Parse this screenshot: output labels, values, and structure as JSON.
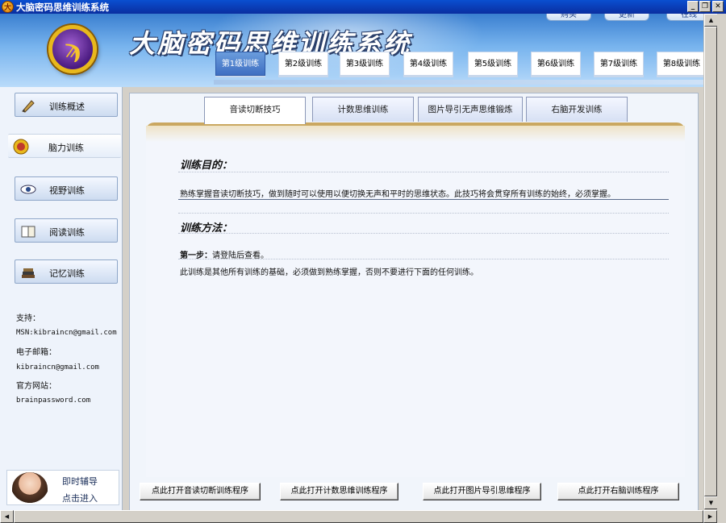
{
  "window": {
    "title": "大脑密码思维训练系统",
    "app_icon_glyph": "大",
    "controls": {
      "minimize": "_",
      "restore": "❐",
      "close": "✕"
    }
  },
  "header": {
    "app_title": "大脑密码思维训练系统",
    "logo_glyph": "ϡ",
    "top_links": [
      "购买",
      "更新",
      "在线"
    ],
    "levels": [
      "第1级训练",
      "第2级训练",
      "第3级训练",
      "第4级训练",
      "第5级训练",
      "第6级训练",
      "第7级训练",
      "第8级训练"
    ],
    "active_level": "第1级训练"
  },
  "sidebar": {
    "items": [
      {
        "label": "训练概述",
        "icon": "pen-icon"
      },
      {
        "label": "脑力训练",
        "icon": "brain-icon"
      },
      {
        "label": "视野训练",
        "icon": "eye-icon"
      },
      {
        "label": "阅读训练",
        "icon": "book-icon"
      },
      {
        "label": "记忆训练",
        "icon": "books-stack-icon"
      }
    ],
    "active_item": "脑力训练",
    "contact": {
      "support_label": "支持：",
      "msn": "MSN:kibraincn@gmail.com",
      "email_label": "电子邮箱：",
      "email": "kibraincn@gmail.com",
      "site_label": "官方网站：",
      "site": "brainpassword.com"
    },
    "help": {
      "line1": "即时辅导",
      "line2": "点击进入"
    }
  },
  "main": {
    "tabs": [
      "音读切断技巧",
      "计数思维训练",
      "图片导引无声思维锻炼",
      "右脑开发训练"
    ],
    "active_tab": "音读切断技巧",
    "goal_title": "训练目的：",
    "goal_text": "熟练掌握音读切断技巧，做到随时可以使用以便切换无声和平时的思维状态。此技巧将会贯穿所有训练的始终，必须掌握。",
    "method_title": "训练方法：",
    "step1_label": "第一步：",
    "step1_text": "请登陆后查看。",
    "method_note": "此训练是其他所有训练的基础，必须做到熟练掌握，否则不要进行下面的任何训练。",
    "buttons": [
      "点此打开音读切断训练程序",
      "点此打开计数思维训练程序",
      "点此打开图片导引思维程序",
      "点此打开右脑训练程序"
    ]
  },
  "scrollbars": {
    "up": "▲",
    "down": "▼",
    "left": "◀",
    "right": "▶"
  },
  "colors": {
    "titlebar": "#0a3fb8",
    "accent": "#3f6fc2",
    "panel_trim": "#caa760"
  }
}
